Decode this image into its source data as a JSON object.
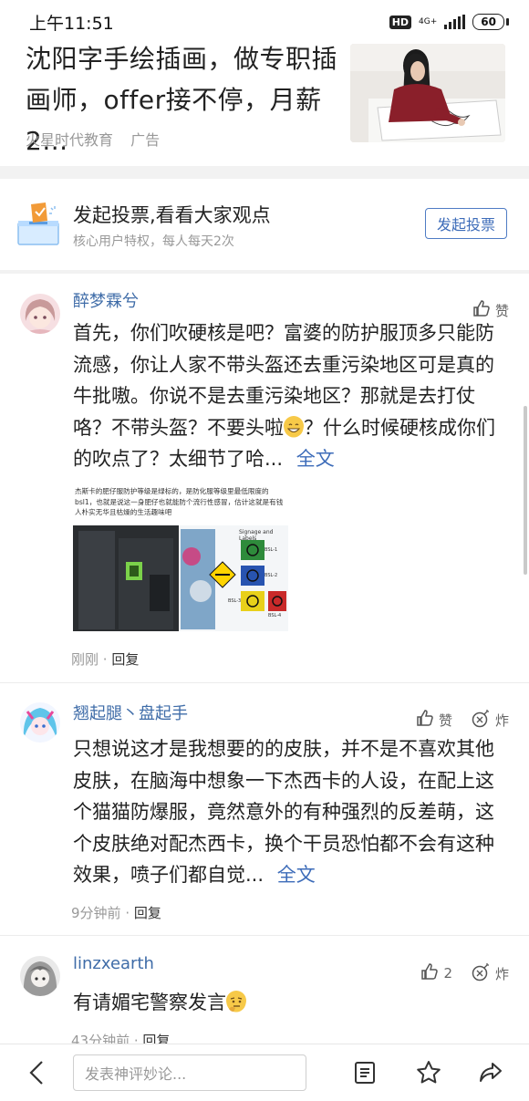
{
  "status_bar": {
    "time": "上午11:51",
    "hd_badge": "HD",
    "network": "4G+",
    "battery": "60"
  },
  "ad": {
    "title": "沈阳字手绘插画，做专职插画师，offer接不停，月薪2...",
    "source": "火星时代教育",
    "tag": "广告"
  },
  "vote": {
    "title": "发起投票,看看大家观点",
    "subtitle": "核心用户特权，每人每天2次",
    "button": "发起投票"
  },
  "comments": [
    {
      "username": "醉梦霖兮",
      "like_label": "赞",
      "body_pre": "首先，你们吹硬核是吧？富婆的防护服顶多只能防流感，你让人家不带头盔还去重污染地区可是真的牛批嗷。你说不是去重污染地区？那就是去打仗咯？不带头盔？不要头啦",
      "body_post": "？什么时候硬核成你们的吹点了？太细节了哈...",
      "more": "全文",
      "image_caption": "杰斯卡的肥仔服防护等级是绿标的，是防化服等级里最低限度的bsl1，也就是说这一身肥仔也就能防个流行性感冒，估计这就是有钱人朴实无华且枯燥的生活趣味吧",
      "image_panel_title": "Signage and Labels",
      "image_levels": [
        "BSL-1",
        "BSL-2",
        "BSL-3",
        "BSL-4"
      ],
      "time": "刚刚",
      "reply": "回复"
    },
    {
      "username": "翘起腿丶盘起手",
      "like_label": "赞",
      "bomb_label": "炸",
      "body": "只想说这才是我想要的的皮肤，并不是不喜欢其他皮肤，在脑海中想象一下杰西卡的人设，在配上这个猫猫防爆服，竟然意外的有种强烈的反差萌，这个皮肤绝对配杰西卡，换个干员恐怕都不会有这种效果，喷子们都自觉...",
      "more": "全文",
      "time": "9分钟前",
      "reply": "回复"
    },
    {
      "username": "linzxearth",
      "like_count": "2",
      "bomb_label": "炸",
      "body": "有请媚宅警察发言",
      "time": "43分钟前",
      "reply": "回复"
    }
  ],
  "bottom_bar": {
    "input_placeholder": "发表神评妙论..."
  },
  "colors": {
    "link_blue": "#3d6cb9",
    "username_blue": "#3f6ca8",
    "muted": "#999999"
  }
}
